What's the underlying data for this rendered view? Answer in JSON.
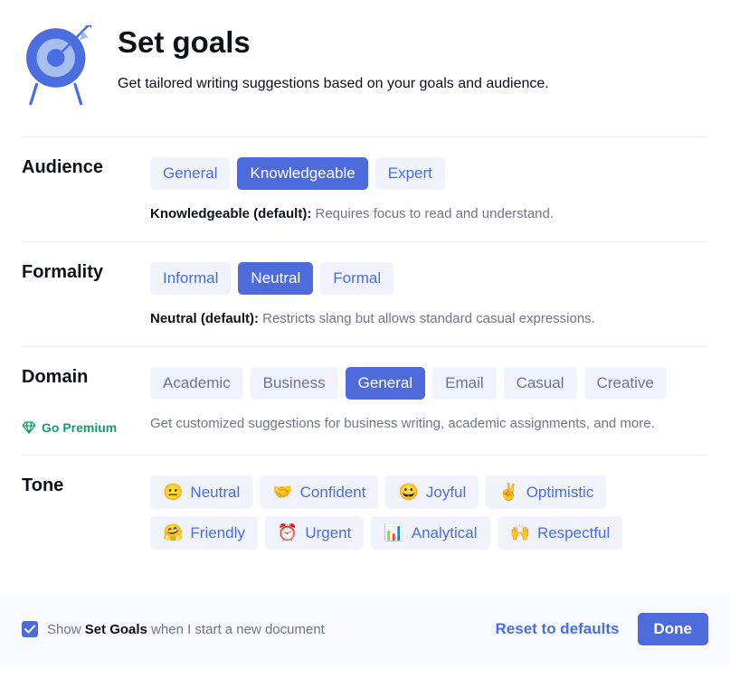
{
  "header": {
    "title": "Set goals",
    "subtitle": "Get tailored writing suggestions based on your goals and audience."
  },
  "audience": {
    "label": "Audience",
    "options": [
      "General",
      "Knowledgeable",
      "Expert"
    ],
    "selected": "Knowledgeable",
    "desc_bold": "Knowledgeable (default):",
    "desc": " Requires focus to read and understand."
  },
  "formality": {
    "label": "Formality",
    "options": [
      "Informal",
      "Neutral",
      "Formal"
    ],
    "selected": "Neutral",
    "desc_bold": "Neutral (default):",
    "desc": " Restricts slang but allows standard casual expressions."
  },
  "domain": {
    "label": "Domain",
    "options": [
      "Academic",
      "Business",
      "General",
      "Email",
      "Casual",
      "Creative"
    ],
    "selected": "General",
    "premium_label": "Go Premium",
    "desc": "Get customized suggestions for business writing, academic assignments, and more."
  },
  "tone": {
    "label": "Tone",
    "options": [
      {
        "emoji": "😐",
        "label": "Neutral"
      },
      {
        "emoji": "🤝",
        "label": "Confident"
      },
      {
        "emoji": "😀",
        "label": "Joyful"
      },
      {
        "emoji": "✌️",
        "label": "Optimistic"
      },
      {
        "emoji": "🤗",
        "label": "Friendly"
      },
      {
        "emoji": "⏰",
        "label": "Urgent"
      },
      {
        "emoji": "📊",
        "label": "Analytical"
      },
      {
        "emoji": "🙌",
        "label": "Respectful"
      }
    ]
  },
  "footer": {
    "show_prefix": "Show ",
    "show_bold": "Set Goals",
    "show_suffix": " when I start a new document",
    "checked": true,
    "reset": "Reset to defaults",
    "done": "Done"
  }
}
